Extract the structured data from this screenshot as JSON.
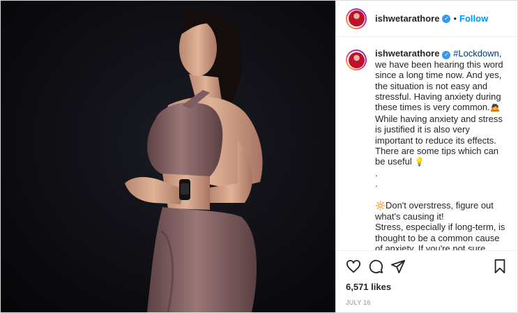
{
  "header": {
    "username": "ishwetarathore",
    "verified_mark": "✓",
    "separator": "•",
    "follow_label": "Follow"
  },
  "caption": {
    "username": "ishwetarathore",
    "verified_mark": "✓",
    "hashtag": "#Lockdown",
    "p1_rest": ", we have been hearing this word since a long time now. And yes, the situation is not easy and stressful. Having anxiety during these times is very common.",
    "p1_emoji": "🙇",
    "p2": "While having anxiety and stress is justified it is also very important to reduce its effects. There are some tips which can be useful",
    "p2_emoji": "💡",
    "dot1": ".",
    "dot2": ".",
    "p3_emoji": "🔆",
    "p3": "Don't overstress, figure out what's causing it!",
    "p4": "Stress, especially if long-term, is thought to be a common cause of anxiety. If you're not sure what's causing your anxiety, start keeping a diary. Write down the stresses that"
  },
  "actions": {
    "like_icon": "heart-icon",
    "comment_icon": "comment-icon",
    "share_icon": "paper-plane-icon",
    "save_icon": "bookmark-icon",
    "likes": "6,571 likes",
    "date": "JULY 16"
  },
  "colors": {
    "link_blue": "#0095f6",
    "verified_blue": "#3897f0",
    "hashtag": "#00376b",
    "outfit": "#8e6a6c"
  }
}
